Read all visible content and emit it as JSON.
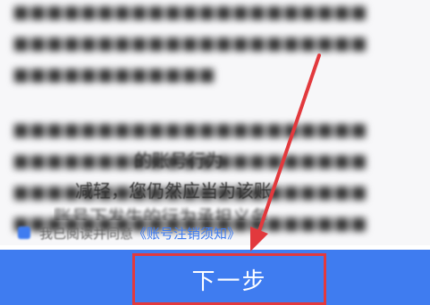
{
  "page": {
    "visible_text_fragments": [
      "的账号行为",
      "减轻，您仍然应当为该账",
      "账号下发生的行为承担义务"
    ],
    "agreement": {
      "prefix": "我已阅读并同意",
      "link": "《账号注销须知》"
    },
    "next_button_label": "下一步"
  },
  "colors": {
    "primary": "#3f7cf0",
    "highlight": "#e2393d"
  },
  "icons": [
    "checkbox-checked-icon",
    "annotation-arrow"
  ]
}
